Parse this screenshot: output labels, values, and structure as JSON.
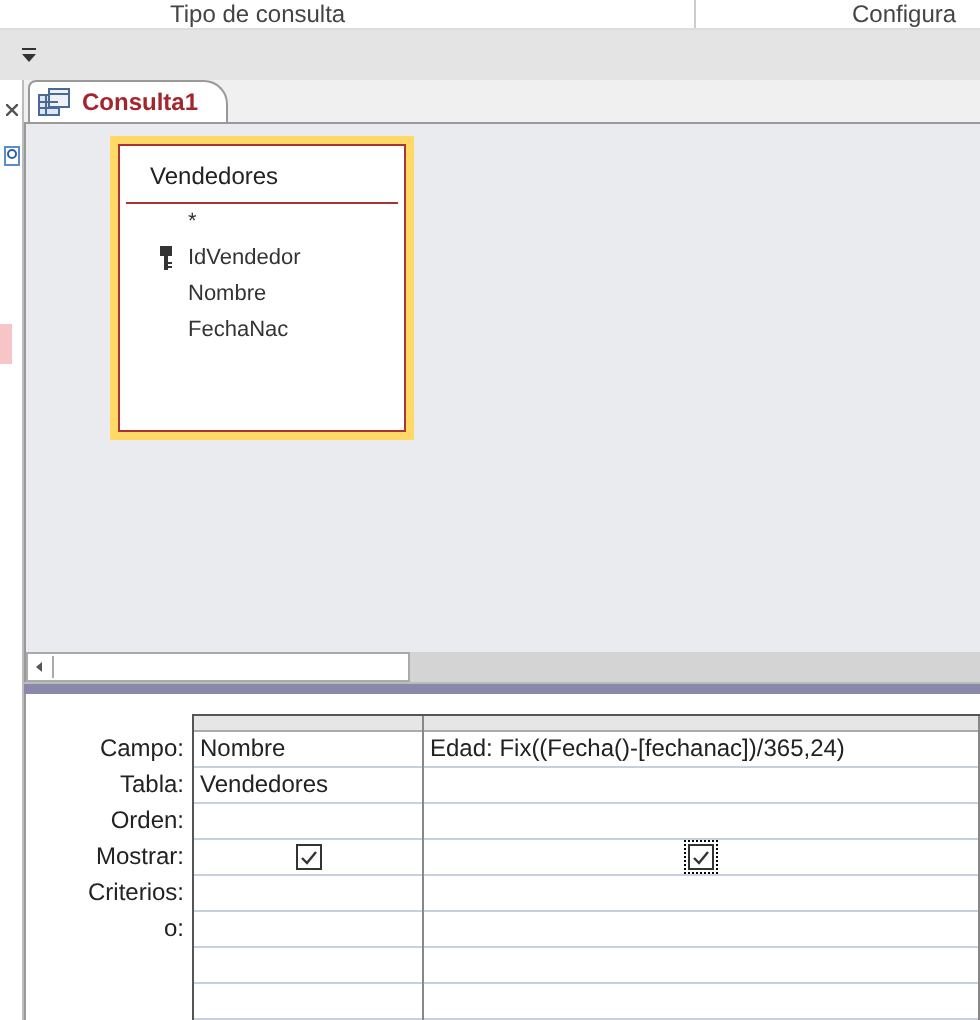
{
  "ribbon": {
    "group_labels": [
      "Tipo de consulta",
      "Configura"
    ]
  },
  "tab": {
    "title": "Consulta1",
    "selected": true
  },
  "table_box": {
    "title": "Vendedores",
    "fields": [
      {
        "name": "*",
        "primary_key": false
      },
      {
        "name": "IdVendedor",
        "primary_key": true
      },
      {
        "name": "Nombre",
        "primary_key": false
      },
      {
        "name": "FechaNac",
        "primary_key": false
      }
    ]
  },
  "grid": {
    "row_labels": [
      "Campo:",
      "Tabla:",
      "Orden:",
      "Mostrar:",
      "Criterios:",
      "o:"
    ],
    "columns": [
      {
        "field": "Nombre",
        "table": "Vendedores",
        "show": true,
        "focused": false
      },
      {
        "field": "Edad: Fix((Fecha()-[fechanac])/365,24)",
        "show": true,
        "focused": true
      }
    ]
  }
}
